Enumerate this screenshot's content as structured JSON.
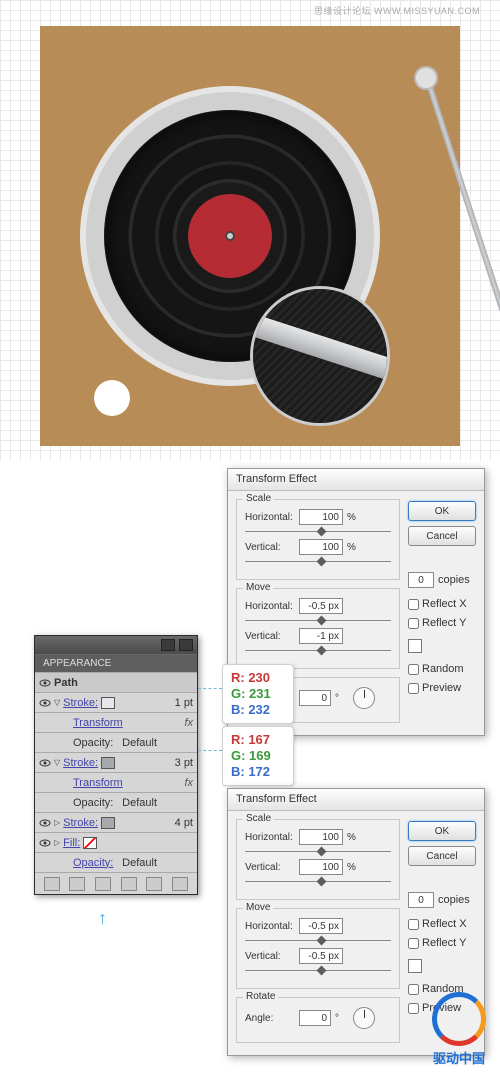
{
  "watermark": "思缘设计论坛  WWW.MISSYUAN.COM",
  "appearance": {
    "title": "APPEARANCE",
    "path": "Path",
    "stroke_label": "Stroke:",
    "fill_label": "Fill:",
    "transform": "Transform",
    "opacity": "Opacity:",
    "opacity_val": "Default",
    "pt1": "1 pt",
    "pt3": "3 pt",
    "pt4": "4 pt"
  },
  "rgb1": {
    "r": "R: 230",
    "g": "G: 231",
    "b": "B: 232"
  },
  "rgb2": {
    "r": "R: 167",
    "g": "G: 169",
    "b": "B: 172"
  },
  "te": {
    "title": "Transform Effect",
    "scale": "Scale",
    "move": "Move",
    "rotate": "Rotate",
    "horizontal": "Horizontal:",
    "vertical": "Vertical:",
    "angle": "Angle:",
    "ok": "OK",
    "cancel": "Cancel",
    "copies": "copies",
    "copies_n": "0",
    "reflectx": "Reflect X",
    "reflecty": "Reflect Y",
    "random": "Random",
    "preview": "Preview",
    "pct": "%",
    "px": "px",
    "deg": "°",
    "d1": {
      "sh": "100",
      "sv": "100",
      "mh": "-0.5 px",
      "mv": "-1 px",
      "ang": "0"
    },
    "d2": {
      "sh": "100",
      "sv": "100",
      "mh": "-0.5 px",
      "mv": "-0.5 px",
      "ang": "0"
    }
  },
  "logo": "驱动中国"
}
